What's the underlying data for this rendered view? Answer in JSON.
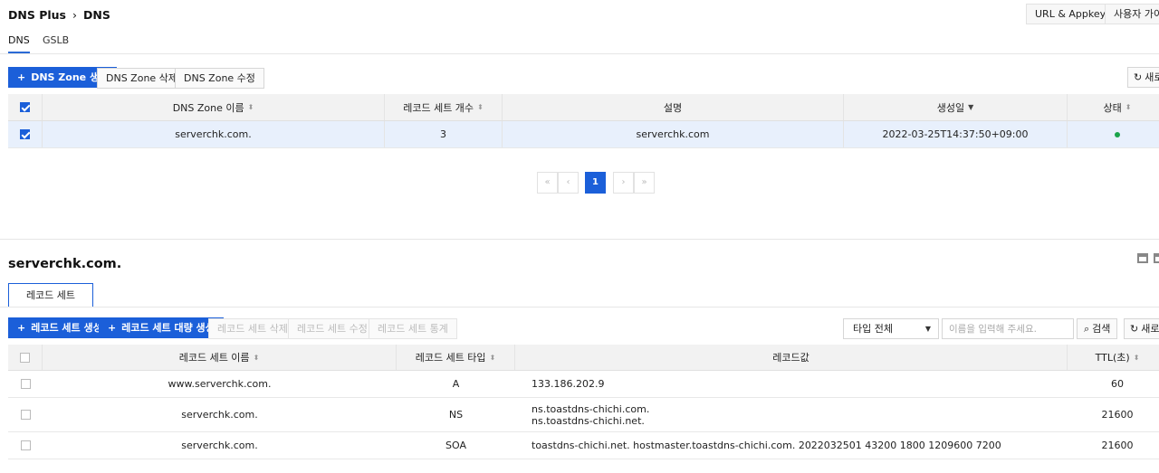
{
  "header": {
    "breadcrumb": [
      "DNS Plus",
      "DNS"
    ],
    "url_appkey": "URL & Appkey",
    "user_guide": "사용자 가이드"
  },
  "tabs": [
    {
      "label": "DNS",
      "active": true
    },
    {
      "label": "GSLB",
      "active": false
    }
  ],
  "zone_toolbar": {
    "create": "DNS Zone 생성",
    "delete": "DNS Zone 삭제",
    "edit": "DNS Zone 수정",
    "refresh": "새로"
  },
  "zone_table": {
    "columns": [
      "DNS Zone 이름",
      "레코드 세트 개수",
      "설명",
      "생성일",
      "상태"
    ],
    "rows": [
      {
        "name": "serverchk.com.",
        "record_count": "3",
        "description": "serverchk.com",
        "created": "2022-03-25T14:37:50+09:00",
        "status": "active",
        "selected": true
      }
    ]
  },
  "pagination": {
    "current": "1",
    "first": "«",
    "prev": "‹",
    "next": "›",
    "last": "»"
  },
  "detail": {
    "title": "serverchk.com.",
    "subtab": "레코드 세트"
  },
  "record_toolbar": {
    "create": "레코드 세트 생성",
    "bulk_create": "레코드 세트 대량 생성",
    "delete": "레코드 세트 삭제",
    "edit": "레코드 세트 수정",
    "stats": "레코드 세트 통계",
    "type_select": "타입 전체",
    "search_placeholder": "이름을 입력해 주세요.",
    "search": "검색",
    "refresh": "새로"
  },
  "record_table": {
    "columns": [
      "레코드 세트 이름",
      "레코드 세트 타입",
      "레코드값",
      "TTL(초)"
    ],
    "rows": [
      {
        "name": "www.serverchk.com.",
        "type": "A",
        "values": [
          "133.186.202.9"
        ],
        "ttl": "60"
      },
      {
        "name": "serverchk.com.",
        "type": "NS",
        "values": [
          "ns.toastdns-chichi.com.",
          "ns.toastdns-chichi.net."
        ],
        "ttl": "21600"
      },
      {
        "name": "serverchk.com.",
        "type": "SOA",
        "values": [
          "toastdns-chichi.net. hostmaster.toastdns-chichi.com. 2022032501 43200 1800 1209600 7200"
        ],
        "ttl": "21600"
      }
    ]
  },
  "colors": {
    "accent": "#1b5fd9",
    "status_active": "#1aa34a",
    "selected_row": "#e8f0fc"
  }
}
